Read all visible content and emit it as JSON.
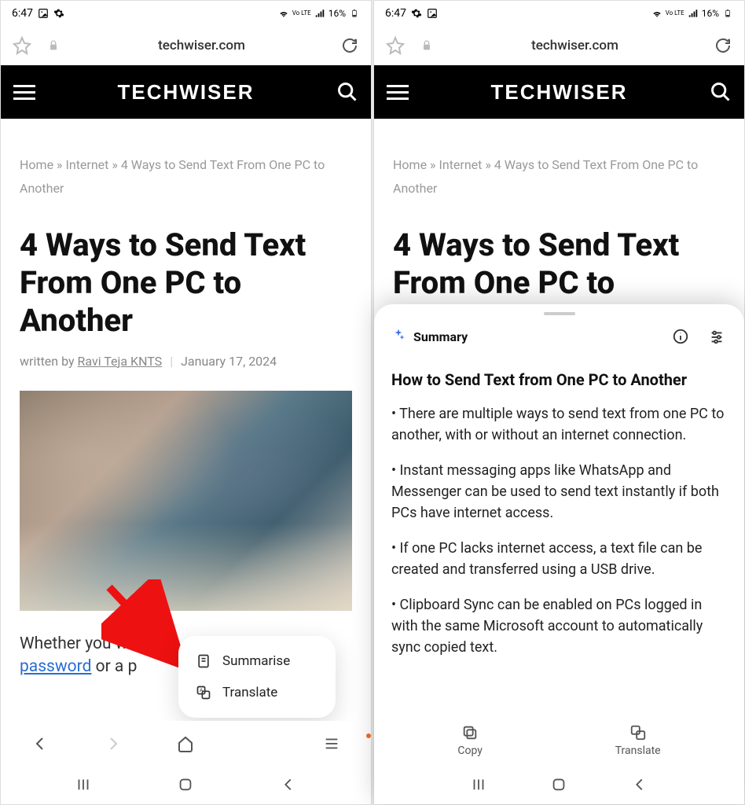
{
  "status": {
    "time": "6:47",
    "battery": "16%",
    "network": "Vo LTE"
  },
  "browser": {
    "url": "techwiser.com"
  },
  "site": {
    "logo": "TECHWISER"
  },
  "article": {
    "breadcrumb_home": "Home",
    "breadcrumb_cat": "Internet",
    "breadcrumb_title": "4 Ways to Send Text From One PC to Another",
    "sep": " » ",
    "title": "4 Ways to Send Text From One PC to Another",
    "title_partial": "4 Ways to Send Text From One PC to",
    "written_by": "written by ",
    "author": "Ravi Teja KNTS",
    "date": "January 17, 2024",
    "body_lead": "Whether you wa",
    "body_link": "password",
    "body_tail": " or a p"
  },
  "popup": {
    "summarise": "Summarise",
    "translate": "Translate"
  },
  "summary": {
    "label": "Summary",
    "heading": "How to Send Text from One PC to Another",
    "bullets": [
      "• There are multiple ways to send text from one PC to another, with or without an internet connection.",
      "• Instant messaging apps like WhatsApp and Messenger can be used to send text instantly if both PCs have internet access.",
      "• If one PC lacks internet access, a text file can be created and transferred using a USB drive.",
      "• Clipboard Sync can be enabled on PCs logged in with the same Microsoft account to automatically sync copied text."
    ],
    "copy": "Copy",
    "translate": "Translate"
  }
}
